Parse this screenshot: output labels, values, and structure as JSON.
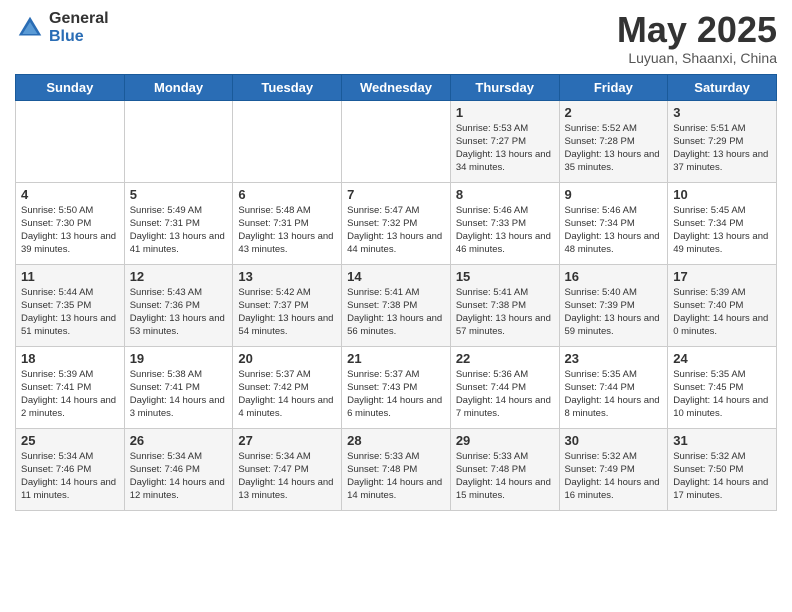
{
  "logo": {
    "general": "General",
    "blue": "Blue"
  },
  "title": "May 2025",
  "location": "Luyuan, Shaanxi, China",
  "days_of_week": [
    "Sunday",
    "Monday",
    "Tuesday",
    "Wednesday",
    "Thursday",
    "Friday",
    "Saturday"
  ],
  "weeks": [
    [
      {
        "day": "",
        "info": ""
      },
      {
        "day": "",
        "info": ""
      },
      {
        "day": "",
        "info": ""
      },
      {
        "day": "",
        "info": ""
      },
      {
        "day": "1",
        "info": "Sunrise: 5:53 AM\nSunset: 7:27 PM\nDaylight: 13 hours\nand 34 minutes."
      },
      {
        "day": "2",
        "info": "Sunrise: 5:52 AM\nSunset: 7:28 PM\nDaylight: 13 hours\nand 35 minutes."
      },
      {
        "day": "3",
        "info": "Sunrise: 5:51 AM\nSunset: 7:29 PM\nDaylight: 13 hours\nand 37 minutes."
      }
    ],
    [
      {
        "day": "4",
        "info": "Sunrise: 5:50 AM\nSunset: 7:30 PM\nDaylight: 13 hours\nand 39 minutes."
      },
      {
        "day": "5",
        "info": "Sunrise: 5:49 AM\nSunset: 7:31 PM\nDaylight: 13 hours\nand 41 minutes."
      },
      {
        "day": "6",
        "info": "Sunrise: 5:48 AM\nSunset: 7:31 PM\nDaylight: 13 hours\nand 43 minutes."
      },
      {
        "day": "7",
        "info": "Sunrise: 5:47 AM\nSunset: 7:32 PM\nDaylight: 13 hours\nand 44 minutes."
      },
      {
        "day": "8",
        "info": "Sunrise: 5:46 AM\nSunset: 7:33 PM\nDaylight: 13 hours\nand 46 minutes."
      },
      {
        "day": "9",
        "info": "Sunrise: 5:46 AM\nSunset: 7:34 PM\nDaylight: 13 hours\nand 48 minutes."
      },
      {
        "day": "10",
        "info": "Sunrise: 5:45 AM\nSunset: 7:34 PM\nDaylight: 13 hours\nand 49 minutes."
      }
    ],
    [
      {
        "day": "11",
        "info": "Sunrise: 5:44 AM\nSunset: 7:35 PM\nDaylight: 13 hours\nand 51 minutes."
      },
      {
        "day": "12",
        "info": "Sunrise: 5:43 AM\nSunset: 7:36 PM\nDaylight: 13 hours\nand 53 minutes."
      },
      {
        "day": "13",
        "info": "Sunrise: 5:42 AM\nSunset: 7:37 PM\nDaylight: 13 hours\nand 54 minutes."
      },
      {
        "day": "14",
        "info": "Sunrise: 5:41 AM\nSunset: 7:38 PM\nDaylight: 13 hours\nand 56 minutes."
      },
      {
        "day": "15",
        "info": "Sunrise: 5:41 AM\nSunset: 7:38 PM\nDaylight: 13 hours\nand 57 minutes."
      },
      {
        "day": "16",
        "info": "Sunrise: 5:40 AM\nSunset: 7:39 PM\nDaylight: 13 hours\nand 59 minutes."
      },
      {
        "day": "17",
        "info": "Sunrise: 5:39 AM\nSunset: 7:40 PM\nDaylight: 14 hours\nand 0 minutes."
      }
    ],
    [
      {
        "day": "18",
        "info": "Sunrise: 5:39 AM\nSunset: 7:41 PM\nDaylight: 14 hours\nand 2 minutes."
      },
      {
        "day": "19",
        "info": "Sunrise: 5:38 AM\nSunset: 7:41 PM\nDaylight: 14 hours\nand 3 minutes."
      },
      {
        "day": "20",
        "info": "Sunrise: 5:37 AM\nSunset: 7:42 PM\nDaylight: 14 hours\nand 4 minutes."
      },
      {
        "day": "21",
        "info": "Sunrise: 5:37 AM\nSunset: 7:43 PM\nDaylight: 14 hours\nand 6 minutes."
      },
      {
        "day": "22",
        "info": "Sunrise: 5:36 AM\nSunset: 7:44 PM\nDaylight: 14 hours\nand 7 minutes."
      },
      {
        "day": "23",
        "info": "Sunrise: 5:35 AM\nSunset: 7:44 PM\nDaylight: 14 hours\nand 8 minutes."
      },
      {
        "day": "24",
        "info": "Sunrise: 5:35 AM\nSunset: 7:45 PM\nDaylight: 14 hours\nand 10 minutes."
      }
    ],
    [
      {
        "day": "25",
        "info": "Sunrise: 5:34 AM\nSunset: 7:46 PM\nDaylight: 14 hours\nand 11 minutes."
      },
      {
        "day": "26",
        "info": "Sunrise: 5:34 AM\nSunset: 7:46 PM\nDaylight: 14 hours\nand 12 minutes."
      },
      {
        "day": "27",
        "info": "Sunrise: 5:34 AM\nSunset: 7:47 PM\nDaylight: 14 hours\nand 13 minutes."
      },
      {
        "day": "28",
        "info": "Sunrise: 5:33 AM\nSunset: 7:48 PM\nDaylight: 14 hours\nand 14 minutes."
      },
      {
        "day": "29",
        "info": "Sunrise: 5:33 AM\nSunset: 7:48 PM\nDaylight: 14 hours\nand 15 minutes."
      },
      {
        "day": "30",
        "info": "Sunrise: 5:32 AM\nSunset: 7:49 PM\nDaylight: 14 hours\nand 16 minutes."
      },
      {
        "day": "31",
        "info": "Sunrise: 5:32 AM\nSunset: 7:50 PM\nDaylight: 14 hours\nand 17 minutes."
      }
    ]
  ]
}
